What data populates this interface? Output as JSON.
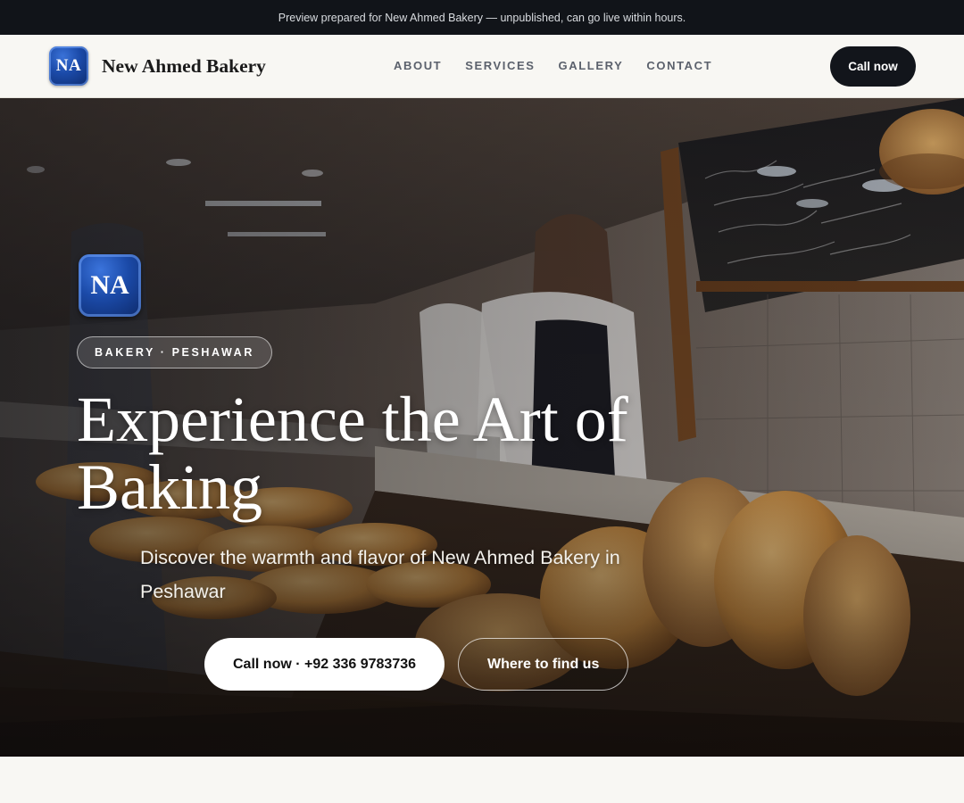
{
  "preview_banner": {
    "text": "Preview prepared for New Ahmed Bakery — unpublished, can go live within hours."
  },
  "header": {
    "logo_initials": "NA",
    "brand_name": "New Ahmed Bakery",
    "nav": [
      {
        "label": "ABOUT"
      },
      {
        "label": "SERVICES"
      },
      {
        "label": "GALLERY"
      },
      {
        "label": "CONTACT"
      }
    ],
    "cta_label": "Call now"
  },
  "hero": {
    "logo_initials": "NA",
    "tag": "BAKERY · PESHAWAR",
    "title": "Experience the Art of Baking",
    "subtitle": "Discover the warmth and flavor of New Ahmed Bakery in Peshawar",
    "primary_button": "Call now · +92 336 9783736",
    "secondary_button": "Where to find us"
  },
  "colors": {
    "banner_bg": "#111419",
    "header_bg": "#f8f7f3",
    "cta_bg": "#12151b",
    "logo_blue": "#1b4aa8"
  }
}
